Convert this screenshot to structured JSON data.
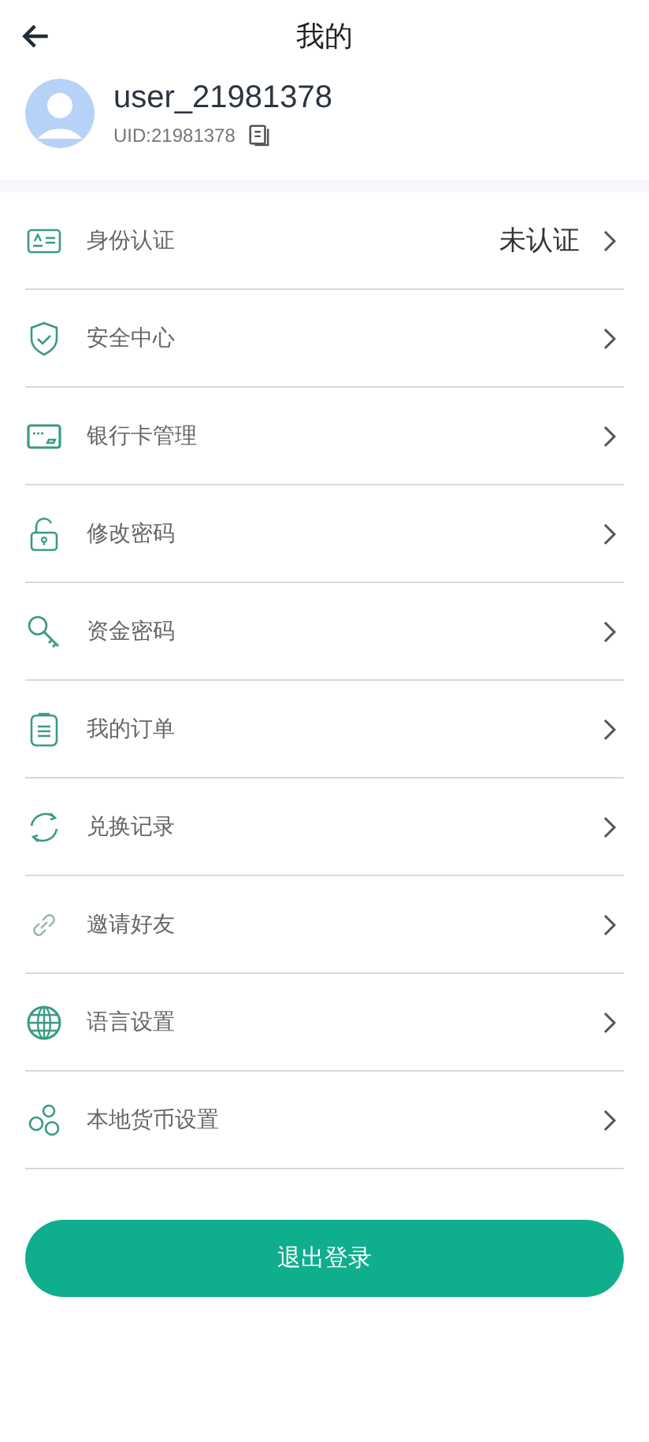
{
  "header": {
    "title": "我的"
  },
  "profile": {
    "username": "user_21981378",
    "uid": "UID:21981378"
  },
  "menu": [
    {
      "kind": "id-card",
      "label": "身份认证",
      "value": "未认证"
    },
    {
      "kind": "shield",
      "label": "安全中心"
    },
    {
      "kind": "bank-card",
      "label": "银行卡管理"
    },
    {
      "kind": "lock",
      "label": "修改密码"
    },
    {
      "kind": "key",
      "label": "资金密码"
    },
    {
      "kind": "clipboard",
      "label": "我的订单"
    },
    {
      "kind": "refresh",
      "label": "兑换记录"
    },
    {
      "kind": "link",
      "label": "邀请好友"
    },
    {
      "kind": "globe",
      "label": "语言设置"
    },
    {
      "kind": "currency",
      "label": "本地货币设置"
    }
  ],
  "logout_button": "退出登录"
}
